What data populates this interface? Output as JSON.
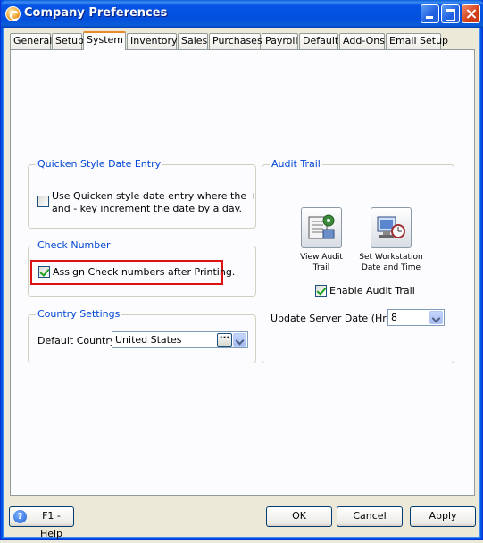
{
  "window": {
    "title": "Company Preferences"
  },
  "tabs": [
    {
      "label": "General"
    },
    {
      "label": "Setup"
    },
    {
      "label": "System"
    },
    {
      "label": "Inventory"
    },
    {
      "label": "Sales"
    },
    {
      "label": "Purchases"
    },
    {
      "label": "Payroll"
    },
    {
      "label": "Default"
    },
    {
      "label": "Add-Ons"
    },
    {
      "label": "Email Setup"
    }
  ],
  "active_tab": "System",
  "quicken_group": {
    "title": "Quicken Style Date Entry",
    "checkbox_label_line1": "Use Quicken style date entry where the +",
    "checkbox_label_line2": "and - key increment the date by a day.",
    "checked": false
  },
  "check_number_group": {
    "title": "Check Number",
    "checkbox_label": "Assign Check numbers after Printing.",
    "checked": true
  },
  "country_group": {
    "title": "Country Settings",
    "field_label": "Default Country",
    "value": "United States"
  },
  "audit_group": {
    "title": "Audit Trail",
    "view_button_line1": "View Audit",
    "view_button_line2": "Trail",
    "set_button_line1": "Set Workstation",
    "set_button_line2": "Date and Time",
    "enable_label": "Enable Audit Trail",
    "enable_checked": true,
    "server_label": "Update Server Date (Hrs)",
    "server_value": "8"
  },
  "footer": {
    "help_label": "F1 - Help",
    "ok_label": "OK",
    "cancel_label": "Cancel",
    "apply_label": "Apply"
  }
}
